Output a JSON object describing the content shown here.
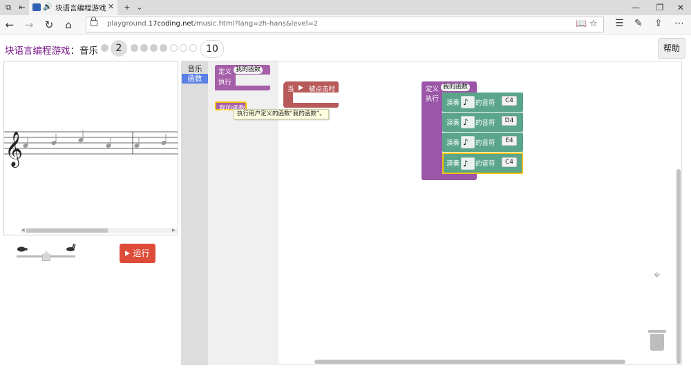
{
  "browser": {
    "tab_title": "块语言编程游戏：音",
    "url_prefix": "playground.",
    "url_domain": "17coding.net",
    "url_path": "/music.html?lang=zh-hans&level=2"
  },
  "header": {
    "title_main": "块语言编程游戏",
    "title_sep": "：",
    "title_sub": "音乐",
    "current_level": "2",
    "last_level": "10",
    "help_label": "帮助"
  },
  "controls": {
    "run_label": "运行"
  },
  "toolbox": {
    "categories": [
      "音乐",
      "函数"
    ],
    "selected": "函数"
  },
  "flyout": {
    "define_label": "定义",
    "func_name": "我的函数",
    "exec_label": "执行",
    "call_label": "我的函数",
    "tooltip": "执行用户定义的函数“我的函数”。"
  },
  "workspace": {
    "event_block": {
      "when_label": "当",
      "clicked_label": "被点击时"
    },
    "define_block": {
      "define_label": "定义",
      "func_name": "我的函数",
      "exec_label": "执行",
      "play_label": "演奏",
      "of_note_label": "的音符",
      "notes": [
        "C4",
        "D4",
        "E4",
        "C4"
      ]
    }
  },
  "colors": {
    "function_block": "#a55fa8",
    "event_block": "#b85a5a",
    "music_block": "#5ba58b",
    "run_button": "#dd4b39",
    "selected_category": "#5b80e6"
  }
}
